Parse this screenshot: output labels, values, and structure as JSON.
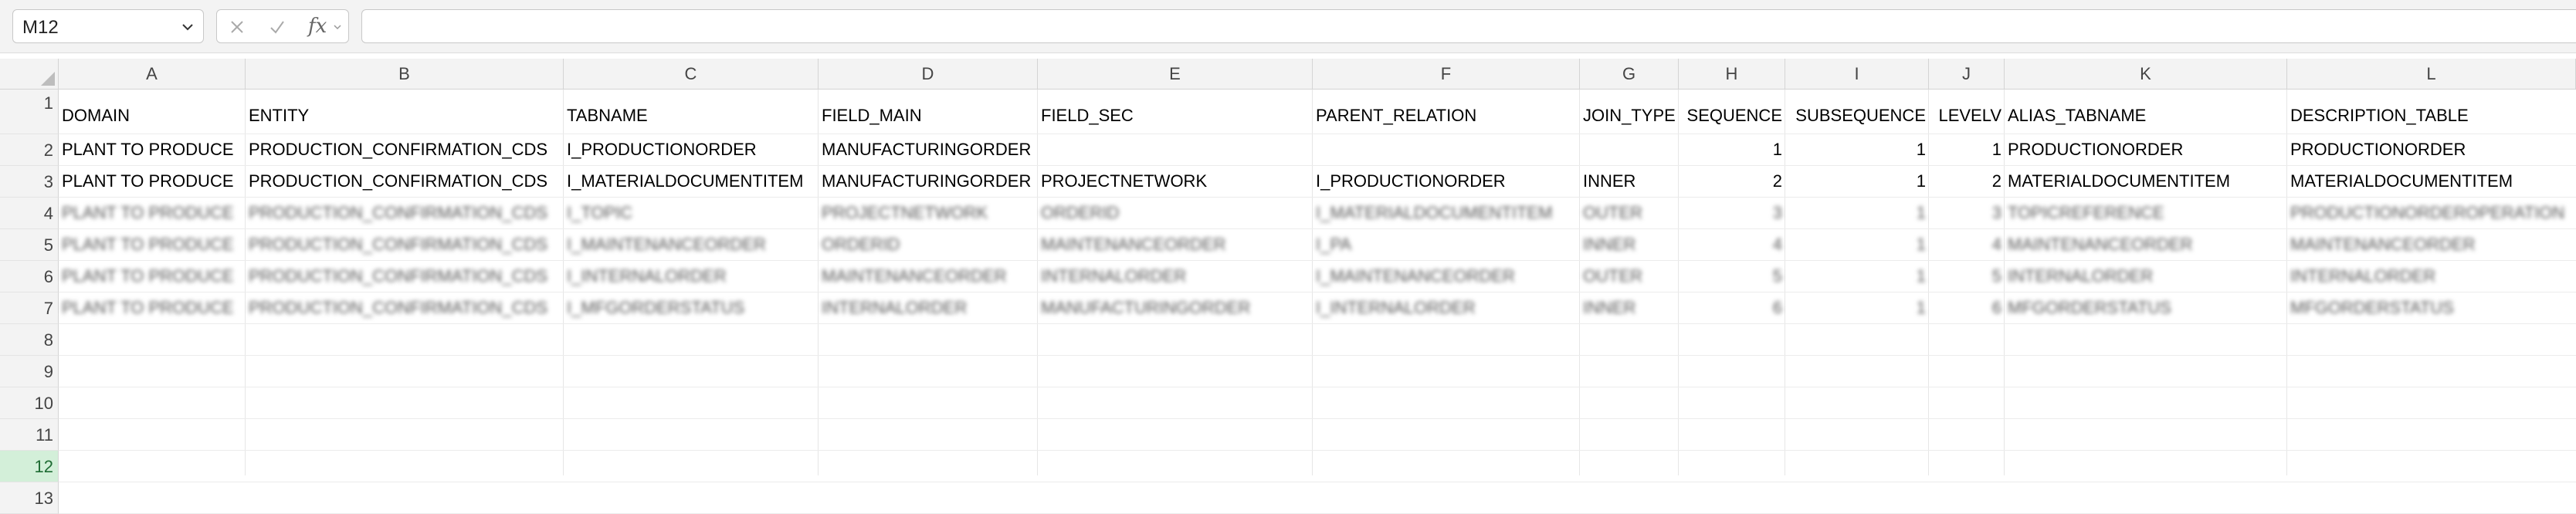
{
  "name_box": {
    "value": "M12"
  },
  "formula": {
    "fx_label": "fx",
    "value": ""
  },
  "columns": [
    "A",
    "B",
    "C",
    "D",
    "E",
    "F",
    "G",
    "H",
    "I",
    "J",
    "K",
    "L"
  ],
  "row_numbers": [
    "1",
    "2",
    "3",
    "4",
    "5",
    "6",
    "7",
    "8",
    "9",
    "10",
    "11",
    "12",
    "13"
  ],
  "selected_row": "12",
  "header_row": [
    "DOMAIN",
    "ENTITY",
    "TABNAME",
    "FIELD_MAIN",
    "FIELD_SEC",
    "PARENT_RELATION",
    "JOIN_TYPE",
    "SEQUENCE",
    "SUBSEQUENCE",
    "LEVELV",
    "ALIAS_TABNAME",
    "DESCRIPTION_TABLE"
  ],
  "data_rows": [
    [
      "PLANT TO PRODUCE",
      "PRODUCTION_CONFIRMATION_CDS",
      "I_PRODUCTIONORDER",
      "MANUFACTURINGORDER",
      "",
      "",
      "",
      "1",
      "1",
      "1",
      "PRODUCTIONORDER",
      "PRODUCTIONORDER"
    ],
    [
      "PLANT TO PRODUCE",
      "PRODUCTION_CONFIRMATION_CDS",
      "I_MATERIALDOCUMENTITEM",
      "MANUFACTURINGORDER",
      "PROJECTNETWORK",
      "I_PRODUCTIONORDER",
      "INNER",
      "2",
      "1",
      "2",
      "MATERIALDOCUMENTITEM",
      "MATERIALDOCUMENTITEM"
    ]
  ],
  "blurred_rows": [
    [
      "PLANT TO PRODUCE",
      "PRODUCTION_CONFIRMATION_CDS",
      "I_TOPIC",
      "PROJECTNETWORK",
      "ORDERID",
      "I_MATERIALDOCUMENTITEM",
      "OUTER",
      "3",
      "1",
      "3",
      "TOPICREFERENCE",
      "PRODUCTIONORDEROPERATION"
    ],
    [
      "PLANT TO PRODUCE",
      "PRODUCTION_CONFIRMATION_CDS",
      "I_MAINTENANCEORDER",
      "ORDERID",
      "MAINTENANCEORDER",
      "I_PA",
      "INNER",
      "4",
      "1",
      "4",
      "MAINTENANCEORDER",
      "MAINTENANCEORDER"
    ],
    [
      "PLANT TO PRODUCE",
      "PRODUCTION_CONFIRMATION_CDS",
      "I_INTERNALORDER",
      "MAINTENANCEORDER",
      "INTERNALORDER",
      "I_MAINTENANCEORDER",
      "OUTER",
      "5",
      "1",
      "5",
      "INTERNALORDER",
      "INTERNALORDER"
    ],
    [
      "PLANT TO PRODUCE",
      "PRODUCTION_CONFIRMATION_CDS",
      "I_MFGORDERSTATUS",
      "INTERNALORDER",
      "MANUFACTURINGORDER",
      "I_INTERNALORDER",
      "INNER",
      "6",
      "1",
      "6",
      "MFGORDERSTATUS",
      "MFGORDERSTATUS"
    ]
  ]
}
